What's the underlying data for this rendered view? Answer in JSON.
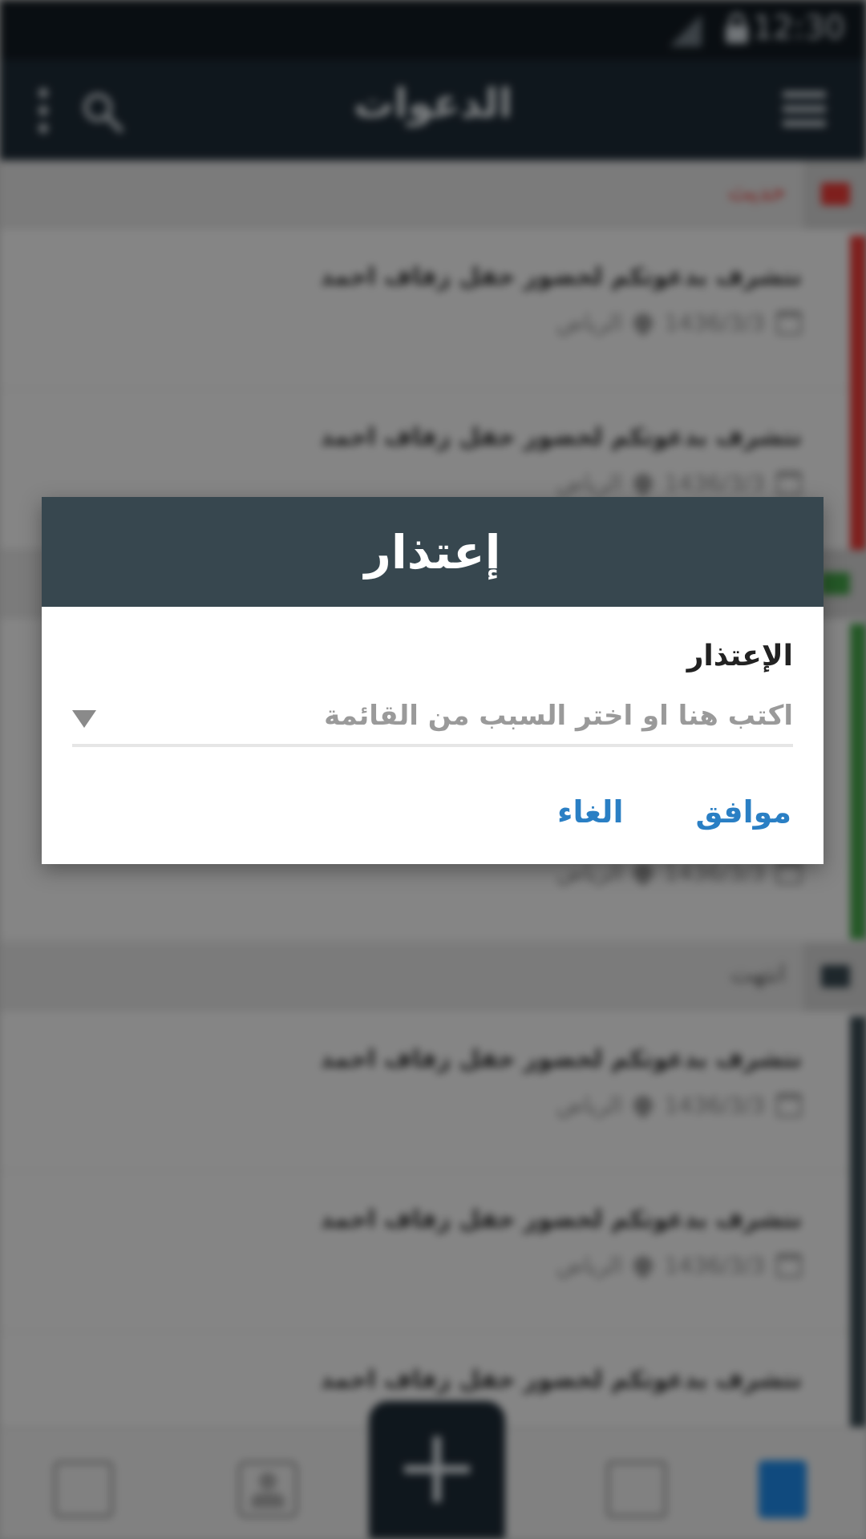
{
  "status_bar": {
    "time": "12:30"
  },
  "app_bar": {
    "title": "الدعوات"
  },
  "sections": [
    {
      "label": "حديث",
      "color": "#e53935",
      "items": [
        {
          "title": "نتشرف بدعوتكم لحضور حفل زفاف احمد",
          "date": "1436/3/3",
          "location": "الرياض"
        },
        {
          "title": "نتشرف بدعوتكم لحضور حفل زفاف احمد",
          "date": "1436/3/3",
          "location": "الرياض"
        }
      ]
    },
    {
      "label": "",
      "color": "#43a047",
      "items": [
        {
          "title": "",
          "date": "1436/3/3",
          "location": "الرياض"
        }
      ]
    },
    {
      "label": "انتهت",
      "color": "#37474f",
      "items": [
        {
          "title": "نتشرف بدعوتكم لحضور حفل زفاف احمد",
          "date": "1436/3/3",
          "location": "الرياض"
        },
        {
          "title": "نتشرف بدعوتكم لحضور حفل زفاف احمد",
          "date": "1436/3/3",
          "location": "الرياض"
        },
        {
          "title": "نتشرف بدعوتكم لحضور حفل زفاف احمد",
          "date": "",
          "location": ""
        }
      ]
    }
  ],
  "dialog": {
    "title": "إعتذار",
    "field_label": "الإعتذار",
    "field_placeholder": "اكتب هنا او اختر السبب من القائمة",
    "field_value": "",
    "ok_label": "موافق",
    "cancel_label": "الغاء",
    "header_color": "#37474f",
    "button_color": "#2a7fc4"
  },
  "bottom_nav": {
    "icons": [
      "list-icon",
      "contacts-icon",
      "add-icon",
      "chat-icon",
      "document-icon"
    ],
    "active_color": "#1e88e5"
  }
}
